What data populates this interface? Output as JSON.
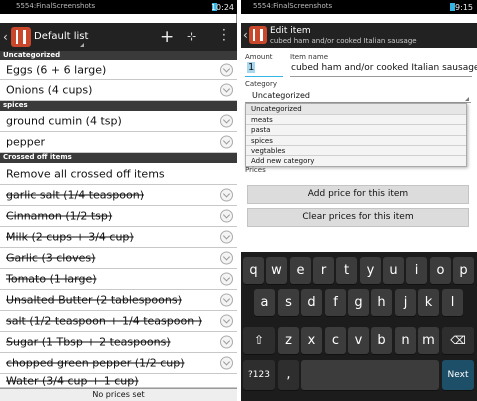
{
  "left": {
    "status_bar": {
      "title": "5554:FinalScreenshots",
      "time": "10:24"
    },
    "action_bar": {
      "list_name": "Default list"
    },
    "sections": [
      {
        "header": "Uncategorized",
        "items": [
          {
            "label": "Eggs (6 + 6 large)"
          },
          {
            "label": "Onions (4 cups)"
          }
        ]
      },
      {
        "header": "spices",
        "items": [
          {
            "label": "ground cumin (4 tsp)"
          },
          {
            "label": "pepper"
          }
        ]
      }
    ],
    "crossed_header": "Crossed off items",
    "remove_all": "Remove all crossed off items",
    "crossed_items": [
      "garlic salt (1/4 teaspoon)",
      "Cinnamon (1/2 tsp)",
      "Milk (2 cups + 3/4 cup)",
      "Garlic (3 cloves)",
      "Tomato (1 large)",
      "Unsalted Butter (2 tablespoons)",
      "salt (1/2 teaspoon + 1/4 teaspoon )",
      "Sugar (1 Tbsp + 2 teaspoons)",
      "chopped green pepper (1/2 cup)",
      "Water (3/4 cup + 1 cup)"
    ],
    "footer": "No prices set"
  },
  "right": {
    "status_bar": {
      "title": "5554:FinalScreenshots",
      "time": "9:15"
    },
    "action_bar": {
      "title": "Edit item",
      "subtitle": "cubed ham and/or cooked Italian sausage"
    },
    "amount_label": "Amount",
    "amount_value": "1",
    "name_label": "Item name",
    "name_value": "cubed ham and/or cooked Italian sausage",
    "category_label": "Category",
    "category_value": "Uncategorized",
    "dropdown_options": [
      "Uncategorized",
      "meats",
      "pasta",
      "spices",
      "vegtables",
      "Add new category"
    ],
    "prices_label": "Prices",
    "add_price_button": "Add price for this item",
    "clear_prices_button": "Clear prices for this item",
    "keyboard": {
      "row1": [
        "q",
        "w",
        "e",
        "r",
        "t",
        "y",
        "u",
        "i",
        "o",
        "p"
      ],
      "row2": [
        "a",
        "s",
        "d",
        "f",
        "g",
        "h",
        "j",
        "k",
        "l"
      ],
      "row3": [
        "z",
        "x",
        "c",
        "v",
        "b",
        "n",
        "m"
      ],
      "sym_key": "?123",
      "comma_key": ",",
      "period_key": ".",
      "next_key": "Next"
    }
  },
  "colors": {
    "accent": "#33b5e5",
    "action_bar": "#222222",
    "section": "#3a3a3a",
    "keyboard": "#1c1c1c"
  }
}
